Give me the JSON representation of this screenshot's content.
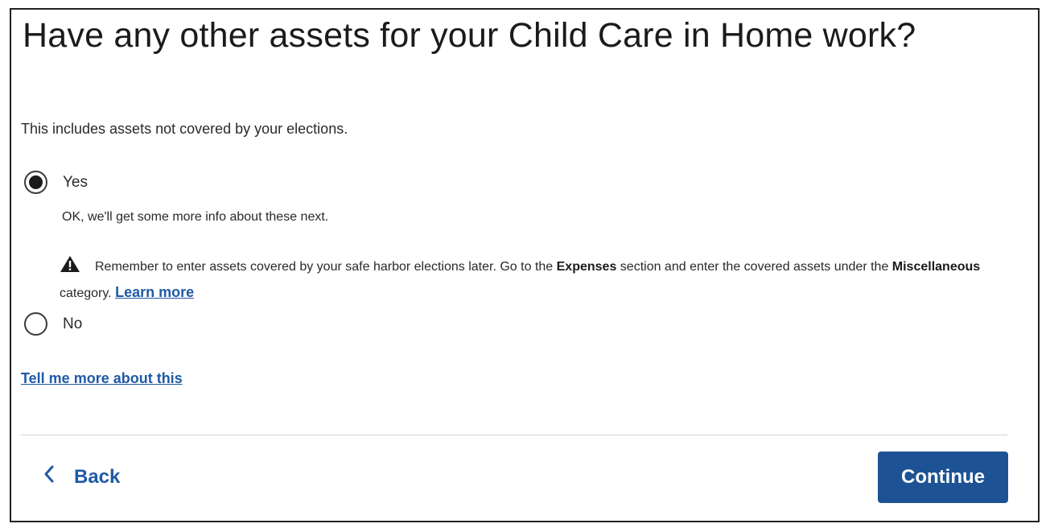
{
  "page": {
    "title": "Have any other assets for your Child Care in Home work?",
    "subtitle": "This includes assets not covered by your elections."
  },
  "question": {
    "options": [
      {
        "label": "Yes",
        "selected": true
      },
      {
        "label": "No",
        "selected": false
      }
    ],
    "yes_detail": "OK, we'll get some more info about these next.",
    "warning": {
      "icon": "warning-triangle-icon",
      "part1": "Remember to enter assets covered by your safe harbor elections later. Go to the ",
      "bold1": "Expenses",
      "part2": " section and enter the covered assets under the ",
      "bold2": "Miscellaneous",
      "part3": " category. ",
      "link": "Learn more"
    }
  },
  "help_link": "Tell me more about this",
  "footer": {
    "back_label": "Back",
    "continue_label": "Continue"
  },
  "colors": {
    "link": "#1f5aa6",
    "primary_button": "#1d5394",
    "text": "#1b1b1b"
  }
}
